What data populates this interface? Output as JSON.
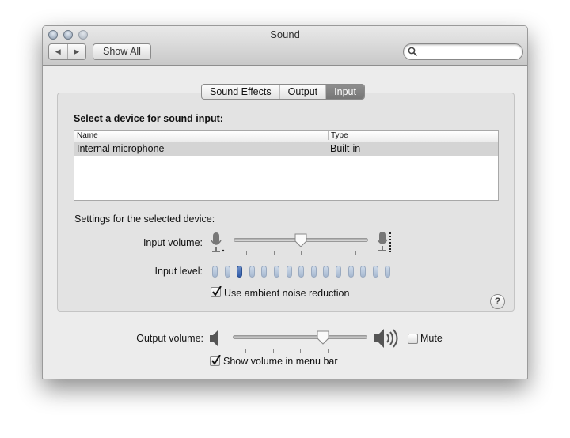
{
  "window": {
    "title": "Sound"
  },
  "toolbar": {
    "back_label": "◀",
    "forward_label": "▶",
    "show_all_label": "Show All",
    "search_placeholder": ""
  },
  "tabs": [
    {
      "label": "Sound Effects"
    },
    {
      "label": "Output"
    },
    {
      "label": "Input",
      "selected": true
    }
  ],
  "input": {
    "heading": "Select a device for sound input:",
    "columns": [
      "Name",
      "Type"
    ],
    "rows": [
      {
        "name": "Internal microphone",
        "type": "Built-in",
        "selected": true
      }
    ],
    "settings_label": "Settings for the selected device:",
    "volume_label": "Input volume:",
    "volume_value": 0.5,
    "level_label": "Input level:",
    "level_segments": 15,
    "level_active_index": 2,
    "noise_reduction_label": "Use ambient noise reduction",
    "noise_reduction_checked": true,
    "help_label": "?"
  },
  "output": {
    "volume_label": "Output volume:",
    "volume_value": 0.67,
    "mute_label": "Mute",
    "mute_checked": false,
    "menu_bar_label": "Show volume in menu bar",
    "menu_bar_checked": true
  },
  "colors": {
    "level_active": "#2f5aa8",
    "level_inactive": "#b8c8dc",
    "tab_selected": "#808080"
  }
}
